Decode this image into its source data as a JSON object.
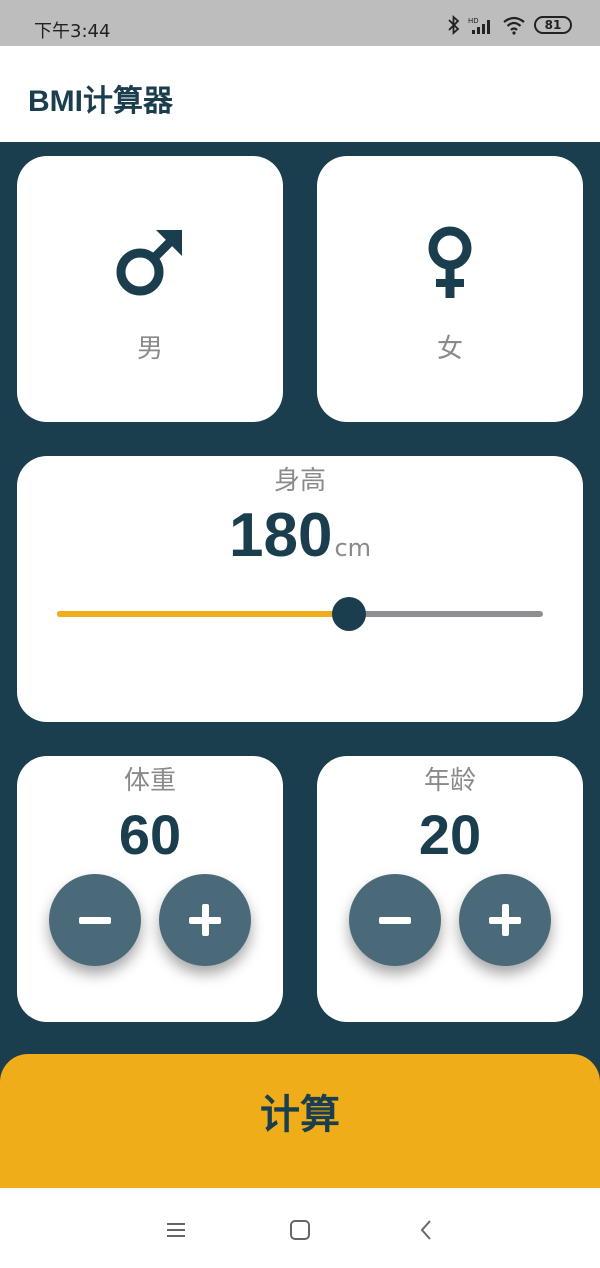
{
  "status_bar": {
    "time": "下午3:44",
    "battery": "81"
  },
  "app": {
    "title": "BMI计算器"
  },
  "gender": {
    "male": {
      "label": "男",
      "icon": "male-symbol-icon"
    },
    "female": {
      "label": "女",
      "icon": "female-symbol-icon"
    }
  },
  "height": {
    "label": "身高",
    "value": "180",
    "unit": "cm",
    "slider_fraction": 0.6
  },
  "weight": {
    "label": "体重",
    "value": "60"
  },
  "age": {
    "label": "年龄",
    "value": "20"
  },
  "calculate": {
    "label": "计算"
  },
  "nav": {
    "icons": [
      "menu-icon",
      "home-square-icon",
      "back-chevron-icon"
    ]
  },
  "colors": {
    "primary": "#1b3e4f",
    "accent": "#efad1a",
    "button": "#4a6a79",
    "muted": "#8a8a8a"
  }
}
